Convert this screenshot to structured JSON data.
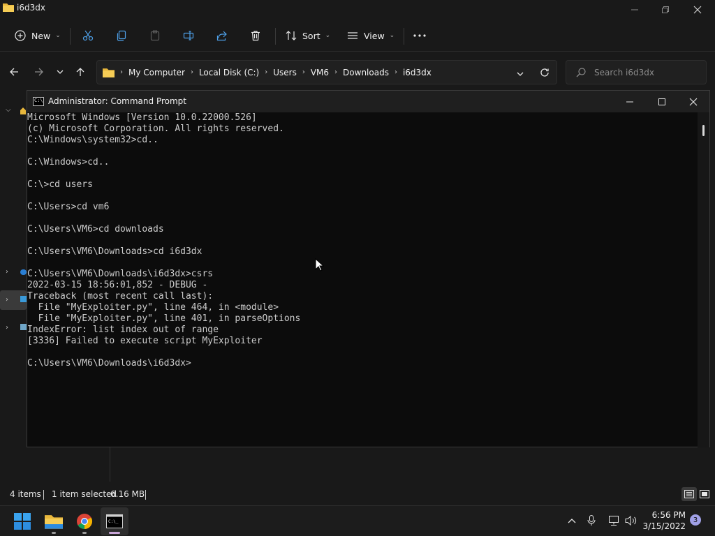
{
  "explorer": {
    "window_title": "i6d3dx",
    "command_bar": {
      "new_label": "New",
      "sort_label": "Sort",
      "view_label": "View"
    },
    "breadcrumbs": [
      "My Computer",
      "Local Disk (C:)",
      "Users",
      "VM6",
      "Downloads",
      "i6d3dx"
    ],
    "search_placeholder": "Search i6d3dx",
    "status": {
      "items_count": "4 items",
      "selection": "1 item selected",
      "size": "6.16 MB"
    }
  },
  "cmd": {
    "title": "Administrator: Command Prompt",
    "lines": [
      "Microsoft Windows [Version 10.0.22000.526]",
      "(c) Microsoft Corporation. All rights reserved.",
      "C:\\Windows\\system32>cd..",
      "",
      "C:\\Windows>cd..",
      "",
      "C:\\>cd users",
      "",
      "C:\\Users>cd vm6",
      "",
      "C:\\Users\\VM6>cd downloads",
      "",
      "C:\\Users\\VM6\\Downloads>cd i6d3dx",
      "",
      "C:\\Users\\VM6\\Downloads\\i6d3dx>csrs",
      "2022-03-15 18:56:01,852 - DEBUG -",
      "Traceback (most recent call last):",
      "  File \"MyExploiter.py\", line 464, in <module>",
      "  File \"MyExploiter.py\", line 401, in parseOptions",
      "IndexError: list index out of range",
      "[3336] Failed to execute script MyExploiter",
      "",
      "C:\\Users\\VM6\\Downloads\\i6d3dx>"
    ]
  },
  "taskbar": {
    "apps": [
      "start-icon",
      "file-explorer-icon",
      "chrome-icon",
      "terminal-icon"
    ],
    "clock": {
      "time": "6:56 PM",
      "date": "3/15/2022"
    },
    "notification_count": "3"
  }
}
